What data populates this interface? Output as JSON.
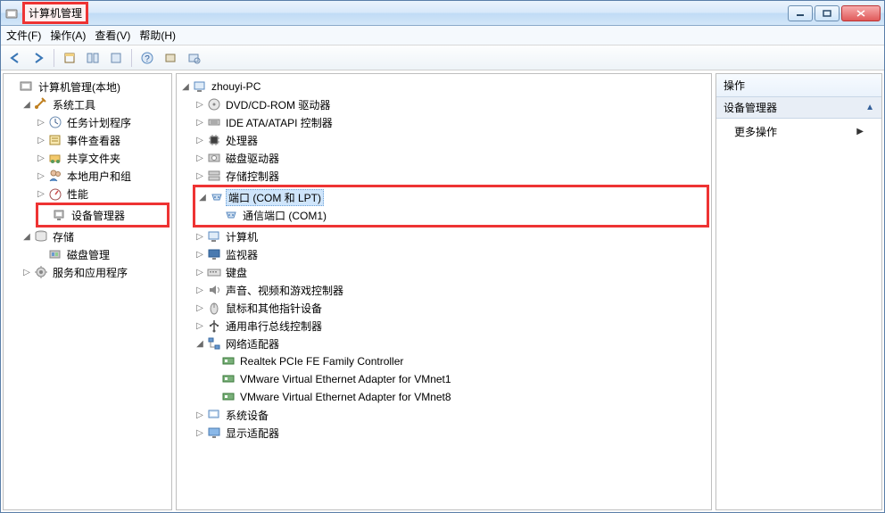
{
  "title": "计算机管理",
  "menu": {
    "file": "文件(F)",
    "action": "操作(A)",
    "view": "查看(V)",
    "help": "帮助(H)"
  },
  "left_tree": {
    "root": "计算机管理(本地)",
    "system_tools": "系统工具",
    "task_scheduler": "任务计划程序",
    "event_viewer": "事件查看器",
    "shared_folders": "共享文件夹",
    "local_users": "本地用户和组",
    "performance": "性能",
    "device_manager": "设备管理器",
    "storage": "存储",
    "disk_mgmt": "磁盘管理",
    "services_apps": "服务和应用程序"
  },
  "mid_tree": {
    "root": "zhouyi-PC",
    "dvd": "DVD/CD-ROM 驱动器",
    "ide": "IDE ATA/ATAPI 控制器",
    "cpu": "处理器",
    "disk_drives": "磁盘驱动器",
    "storage_ctrl": "存储控制器",
    "ports": "端口 (COM 和 LPT)",
    "com1": "通信端口 (COM1)",
    "computer": "计算机",
    "monitor": "监视器",
    "keyboard": "键盘",
    "audio": "声音、视频和游戏控制器",
    "mouse": "鼠标和其他指针设备",
    "usb": "通用串行总线控制器",
    "net": "网络适配器",
    "net1": "Realtek PCIe FE Family Controller",
    "net2": "VMware Virtual Ethernet Adapter for VMnet1",
    "net3": "VMware Virtual Ethernet Adapter for VMnet8",
    "sysdev": "系统设备",
    "display": "显示适配器"
  },
  "right": {
    "header": "操作",
    "section": "设备管理器",
    "more": "更多操作"
  }
}
